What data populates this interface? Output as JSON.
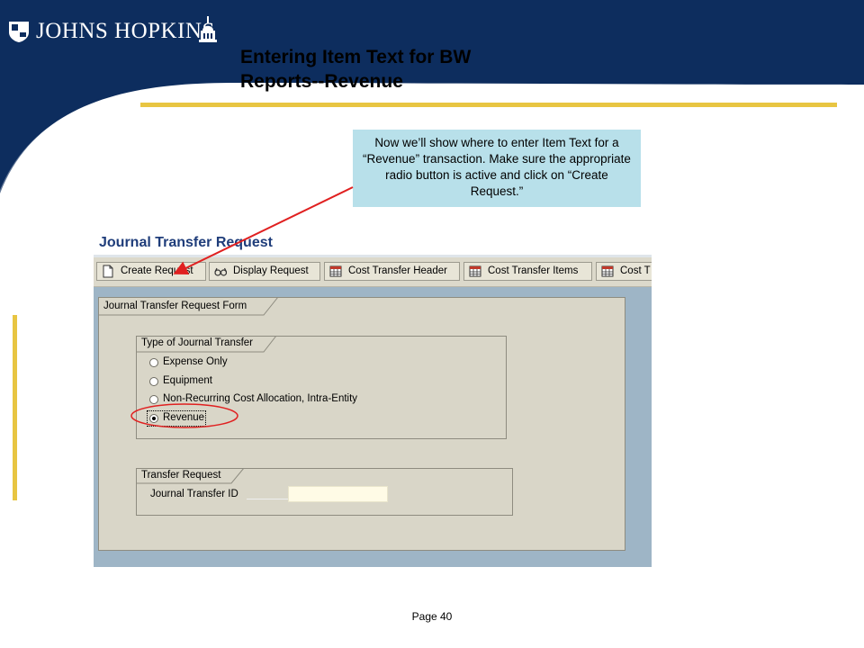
{
  "header": {
    "logo_text": "JOHNS HOPKINS",
    "title_line1": "Entering Item Text for BW",
    "title_line2": "Reports--Revenue"
  },
  "callout": {
    "text": "Now we’ll show where to enter Item Text for a “Revenue” transaction. Make sure the appropriate radio button is active and click on “Create Request.”"
  },
  "sap": {
    "title": "Journal Transfer Request",
    "toolbar": [
      {
        "label": "Create Request",
        "icon": "document-icon"
      },
      {
        "label": "Display Request",
        "icon": "glasses-icon"
      },
      {
        "label": "Cost Transfer Header",
        "icon": "table-icon"
      },
      {
        "label": "Cost Transfer Items",
        "icon": "table-icon"
      },
      {
        "label": "Cost T",
        "icon": "table-icon"
      }
    ],
    "form_title": "Journal Transfer Request Form",
    "type_group": {
      "label": "Type of Journal Transfer",
      "options": [
        {
          "label": "Expense Only",
          "selected": false
        },
        {
          "label": "Equipment",
          "selected": false
        },
        {
          "label": "Non-Recurring Cost Allocation, Intra-Entity",
          "selected": false
        },
        {
          "label": "Revenue",
          "selected": true
        }
      ]
    },
    "transfer_group": {
      "label": "Transfer Request",
      "field_label": "Journal Transfer ID",
      "field_value": ""
    }
  },
  "footer": {
    "page_label": "Page 40"
  },
  "colors": {
    "navy": "#0d2d5e",
    "gold": "#e8c542",
    "callout_bg": "#b8e0ea",
    "annotation_red": "#e02020"
  }
}
